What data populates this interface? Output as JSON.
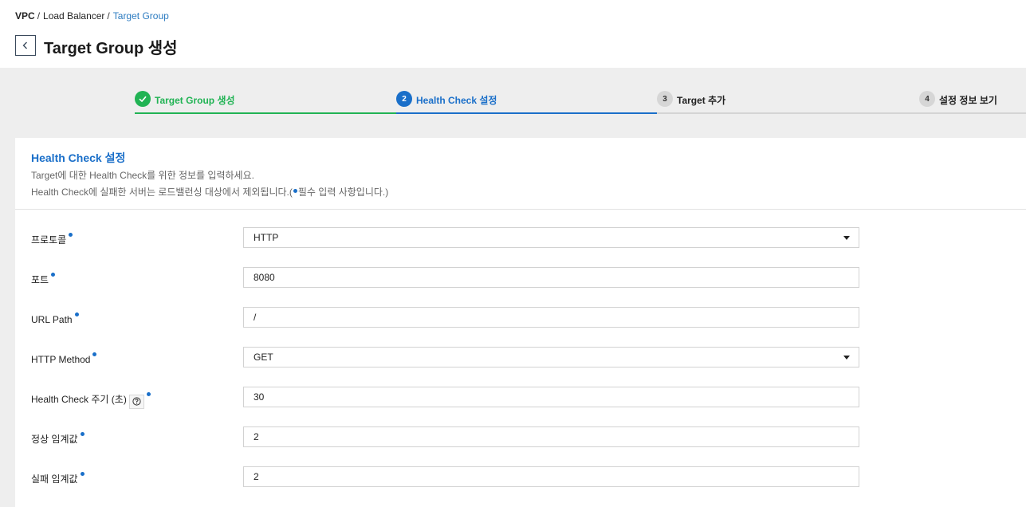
{
  "breadcrumb": [
    {
      "label": "VPC"
    },
    {
      "label": "Load Balancer"
    },
    {
      "label": "Target Group"
    }
  ],
  "breadcrumb_sep": "/",
  "page_title": "Target Group 생성",
  "steps": [
    {
      "num": "",
      "label": "Target Group 생성",
      "state": "done"
    },
    {
      "num": "2",
      "label": "Health Check 설정",
      "state": "active"
    },
    {
      "num": "3",
      "label": "Target 추가",
      "state": "pending"
    },
    {
      "num": "4",
      "label": "설정 정보 보기",
      "state": "pending"
    }
  ],
  "section": {
    "title": "Health Check 설정",
    "desc1": "Target에 대한 Health Check를 위한 정보를 입력하세요.",
    "desc2_prefix": "Health Check에 실패한 서버는 로드밸런싱 대상에서 제외됩니다.(",
    "desc2_suffix": "필수 입력 사항입니다.)"
  },
  "form": {
    "protocol": {
      "label": "프로토콜",
      "value": "HTTP"
    },
    "port": {
      "label": "포트",
      "value": "8080"
    },
    "url_path": {
      "label": "URL Path",
      "value": "/"
    },
    "http_method": {
      "label": "HTTP Method",
      "value": "GET"
    },
    "interval": {
      "label": "Health Check 주기 (초)",
      "value": "30"
    },
    "healthy_threshold": {
      "label": "정상 임계값",
      "value": "2"
    },
    "unhealthy_threshold": {
      "label": "실패 임계값",
      "value": "2"
    }
  },
  "colors": {
    "accent": "#1a6fc9",
    "success": "#21b354",
    "link": "#2d7cc1"
  },
  "icons": {
    "back": "chevron-left-icon",
    "done_step": "check-icon",
    "help": "help-icon",
    "select": "caret-down-icon"
  }
}
